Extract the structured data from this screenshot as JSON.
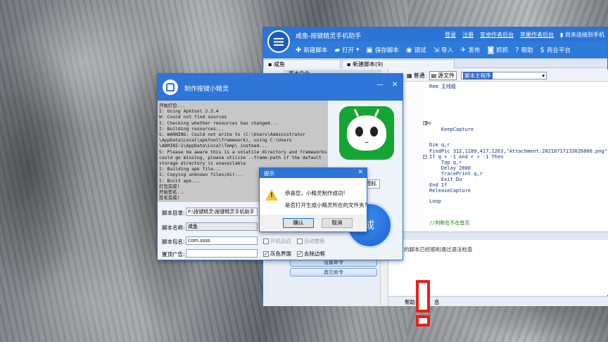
{
  "ide": {
    "title": "咸鱼-按键精灵手机助手",
    "links": [
      "登录",
      "注册",
      "安卓作者后台",
      "苹果作者后台"
    ],
    "connection_status": "尚未连接到手机",
    "toolbar": {
      "new_script": "新建脚本",
      "open": "打开",
      "save_script": "保存脚本",
      "debug": "调试",
      "import": "导入",
      "publish": "发布",
      "capture": "抓抓",
      "help": "帮助",
      "business": "商业平台"
    },
    "tabs": [
      "咸鱼",
      "新建脚本(9)"
    ],
    "left_panel": {
      "header": "基本命令",
      "commands": [
        "设置命令",
        "其它命令"
      ]
    },
    "editor_tabs": [
      "普通",
      "源文件"
    ],
    "procedure_select": "脚本主程序",
    "code_lines": [
      "Rem 主线程",
      "Do",
      "    KeepCapture",
      "Dim q,r",
      "FindPic 312,1189,417,1263,\"Attachment:20210717133026860.png\",\"000",
      "If q > -1 And r > -1 Then",
      "    Tap q,r",
      "    Delay 2000",
      "    TracePrint q,r",
      "    Exit Do",
      "End If",
      "ReleaseCapture",
      "Loop",
      "//判断在不在首页"
    ],
    "output_text": "的脚本已经顺利通过语法检查",
    "bottom_tabs": [
      "帮助",
      "息"
    ]
  },
  "build_window": {
    "title": "制作按键小精灵",
    "console_lines": [
      "开始打包...",
      "I: Using Apktool 2.3.4",
      "W: Could not find sources",
      "I: Checking whether resources has changed...",
      "I: Building resources...",
      "S: WARNING: Could not write to (C:\\Users\\Administrator",
      "\\AppData\\Local\\apktool\\framework), using C:\\Users",
      "\\ADMINI~1\\AppData\\Local\\Temp\\ instead...",
      "S: Please be aware this is a volatile directory and frameworks",
      "could go missing, please utilize --frame-path if the default",
      "storage directory is unavailable",
      "I: Building apk file...",
      "I: Copying unknown files/dir...",
      "I: Built apk...",
      "打包完成!",
      "开始签名...",
      "签名完成!"
    ],
    "icon_button": "图标",
    "script_dir_label": "脚本目录:",
    "script_dir_value": "F:\\按键精灵\\按键精灵手机助手",
    "script_name_label": "脚本名称:",
    "script_name_value": "咸鱼",
    "package_name_label": "脚本包名:",
    "package_name_value": "com.ssss",
    "ad_label": "置顶广告:",
    "ad_value": "",
    "options": [
      {
        "label": "开机自启",
        "checked": false,
        "enabled": false
      },
      {
        "label": "自动更新",
        "checked": false,
        "enabled": false
      },
      {
        "label": "灰色界面",
        "checked": true,
        "enabled": true
      },
      {
        "label": "去除边框",
        "checked": true,
        "enabled": true
      }
    ],
    "build_button": "成"
  },
  "dialog": {
    "title": "提示",
    "line1": "恭喜您，小精灵制作成功!",
    "line2": "是否打开生成小精灵所在的文件夹?",
    "confirm": "确认",
    "cancel": "取消"
  },
  "colors": {
    "title_blue": "#2b74d6",
    "accent_green": "#15a533",
    "annotation_red": "#e8201b"
  }
}
